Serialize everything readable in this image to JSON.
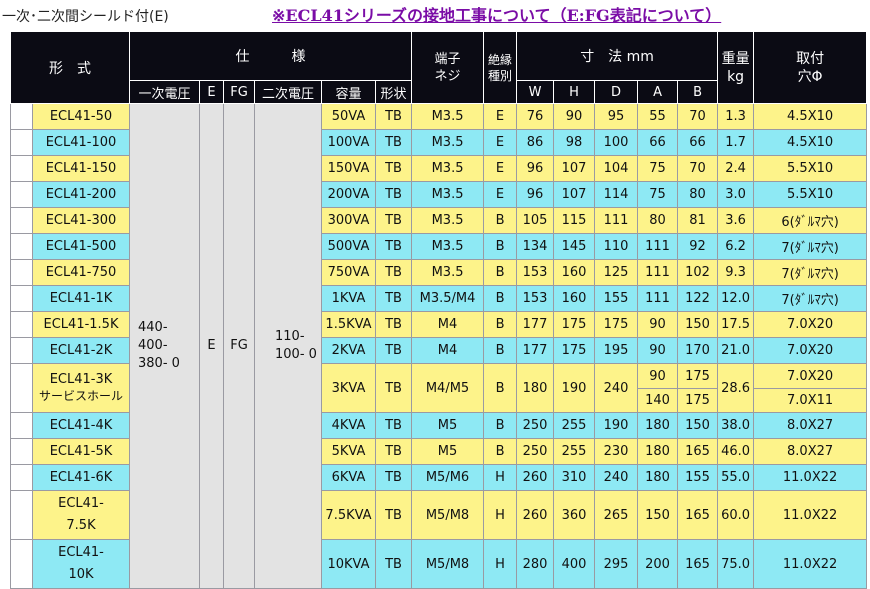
{
  "header": {
    "caption": "一次･二次間シールド付(E)",
    "notice": "※ECL41シリーズの接地工事について（E:FG表記について）"
  },
  "table": {
    "head1": {
      "model": "形　式",
      "spec": "仕　　　様",
      "terminal": "端子\nネジ",
      "insulation": "絶縁\n種別",
      "dims": "寸　法 mm",
      "weight": "重量\nkg",
      "mount": "取付\n穴Φ"
    },
    "head2": [
      "一次電圧",
      "E",
      "FG",
      "二次電圧",
      "容量",
      "形状"
    ],
    "dims_cols": [
      "W",
      "H",
      "D",
      "A",
      "B"
    ],
    "shared": {
      "primary": "440-\n400-\n380-\n0",
      "e": "E",
      "fg": "FG",
      "secondary": "110-\n100-\n0"
    },
    "rows": [
      {
        "model": "ECL41-50",
        "cap": "50VA",
        "shape": "TB",
        "screw": "M3.5",
        "ins": "E",
        "w": "76",
        "h": "90",
        "d": "95",
        "a": "55",
        "b": "70",
        "kg": "1.3",
        "mount": "4.5X10"
      },
      {
        "model": "ECL41-100",
        "cap": "100VA",
        "shape": "TB",
        "screw": "M3.5",
        "ins": "E",
        "w": "86",
        "h": "98",
        "d": "100",
        "a": "66",
        "b": "66",
        "kg": "1.7",
        "mount": "4.5X10"
      },
      {
        "model": "ECL41-150",
        "cap": "150VA",
        "shape": "TB",
        "screw": "M3.5",
        "ins": "E",
        "w": "96",
        "h": "107",
        "d": "104",
        "a": "75",
        "b": "70",
        "kg": "2.4",
        "mount": "5.5X10"
      },
      {
        "model": "ECL41-200",
        "cap": "200VA",
        "shape": "TB",
        "screw": "M3.5",
        "ins": "E",
        "w": "96",
        "h": "107",
        "d": "114",
        "a": "75",
        "b": "80",
        "kg": "3.0",
        "mount": "5.5X10"
      },
      {
        "model": "ECL41-300",
        "cap": "300VA",
        "shape": "TB",
        "screw": "M3.5",
        "ins": "B",
        "w": "105",
        "h": "115",
        "d": "111",
        "a": "80",
        "b": "81",
        "kg": "3.6",
        "mount": "6(ﾀﾞﾙﾏ穴)"
      },
      {
        "model": "ECL41-500",
        "cap": "500VA",
        "shape": "TB",
        "screw": "M3.5",
        "ins": "B",
        "w": "134",
        "h": "145",
        "d": "110",
        "a": "111",
        "b": "92",
        "kg": "6.2",
        "mount": "7(ﾀﾞﾙﾏ穴)"
      },
      {
        "model": "ECL41-750",
        "cap": "750VA",
        "shape": "TB",
        "screw": "M3.5",
        "ins": "B",
        "w": "153",
        "h": "160",
        "d": "125",
        "a": "111",
        "b": "102",
        "kg": "9.3",
        "mount": "7(ﾀﾞﾙﾏ穴)"
      },
      {
        "model": "ECL41-1K",
        "cap": "1KVA",
        "shape": "TB",
        "screw": "M3.5/M4",
        "ins": "B",
        "w": "153",
        "h": "160",
        "d": "155",
        "a": "111",
        "b": "122",
        "kg": "12.0",
        "mount": "7(ﾀﾞﾙﾏ穴)"
      },
      {
        "model": "ECL41-1.5K",
        "cap": "1.5KVA",
        "shape": "TB",
        "screw": "M4",
        "ins": "B",
        "w": "177",
        "h": "175",
        "d": "175",
        "a": "90",
        "b": "150",
        "kg": "17.5",
        "mount": "7.0X20"
      },
      {
        "model": "ECL41-2K",
        "cap": "2KVA",
        "shape": "TB",
        "screw": "M4",
        "ins": "B",
        "w": "177",
        "h": "175",
        "d": "195",
        "a": "90",
        "b": "170",
        "kg": "21.0",
        "mount": "7.0X20"
      },
      {
        "model": "ECL41-3K",
        "model2": "サービスホール",
        "cap": "3KVA",
        "shape": "TB",
        "screw": "M4/M5",
        "ins": "B",
        "w": "180",
        "h": "190",
        "d": "240",
        "a": "90",
        "b": "175",
        "a2": "140",
        "b2": "175",
        "kg": "28.6",
        "mount": "7.0X20",
        "mount2": "7.0X11"
      },
      {
        "model": "ECL41-4K",
        "cap": "4KVA",
        "shape": "TB",
        "screw": "M5",
        "ins": "B",
        "w": "250",
        "h": "255",
        "d": "190",
        "a": "180",
        "b": "150",
        "kg": "38.0",
        "mount": "8.0X27"
      },
      {
        "model": "ECL41-5K",
        "cap": "5KVA",
        "shape": "TB",
        "screw": "M5",
        "ins": "B",
        "w": "250",
        "h": "255",
        "d": "230",
        "a": "180",
        "b": "165",
        "kg": "46.0",
        "mount": "8.0X27"
      },
      {
        "model": "ECL41-6K",
        "cap": "6KVA",
        "shape": "TB",
        "screw": "M5/M6",
        "ins": "H",
        "w": "260",
        "h": "310",
        "d": "240",
        "a": "180",
        "b": "155",
        "kg": "55.0",
        "mount": "11.0X22"
      },
      {
        "model": "ECL41-\n7.5K",
        "cap": "7.5KVA",
        "shape": "TB",
        "screw": "M5/M8",
        "ins": "H",
        "w": "260",
        "h": "360",
        "d": "265",
        "a": "150",
        "b": "165",
        "kg": "60.0",
        "mount": "11.0X22"
      },
      {
        "model": "ECL41-\n10K",
        "cap": "10KVA",
        "shape": "TB",
        "screw": "M5/M8",
        "ins": "H",
        "w": "280",
        "h": "400",
        "d": "295",
        "a": "200",
        "b": "165",
        "kg": "75.0",
        "mount": "11.0X22"
      }
    ]
  },
  "colors": {
    "yellow": "#fdf38a",
    "cyan": "#8ee9f4",
    "header_bg": "#0b0b14",
    "notice": "#7a0ca6",
    "shared_cell": "#e3e3e3"
  }
}
